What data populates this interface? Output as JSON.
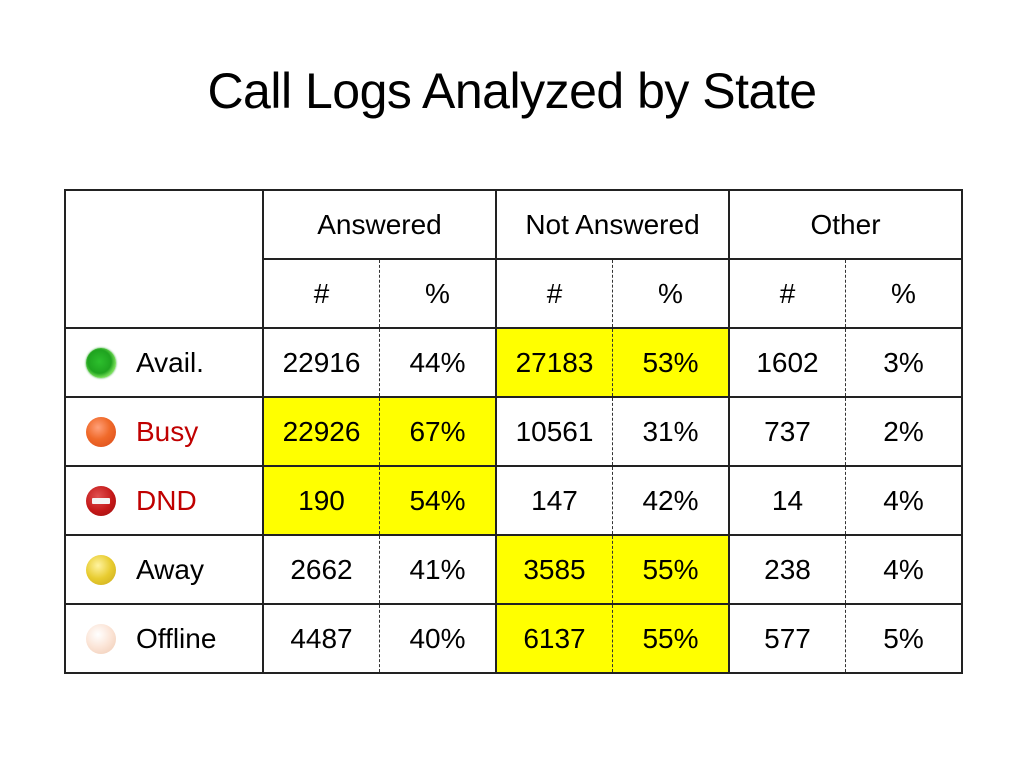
{
  "title": "Call Logs Analyzed by State",
  "headers": {
    "groups": [
      "Answered",
      "Not Answered",
      "Other"
    ],
    "sub": [
      "#",
      "%",
      "#",
      "%",
      "#",
      "%"
    ]
  },
  "highlight_color": "#ffff00",
  "rows": [
    {
      "state": "Avail.",
      "icon": "green-status-icon",
      "label_color": "#000000",
      "cells": [
        "22916",
        "44%",
        "27183",
        "53%",
        "1602",
        "3%"
      ],
      "highlight": [
        "not_answered"
      ]
    },
    {
      "state": "Busy",
      "icon": "orange-status-icon",
      "label_color": "#c00000",
      "cells": [
        "22926",
        "67%",
        "10561",
        "31%",
        "737",
        "2%"
      ],
      "highlight": [
        "answered"
      ]
    },
    {
      "state": "DND",
      "icon": "do-not-disturb-icon",
      "label_color": "#c00000",
      "cells": [
        "190",
        "54%",
        "147",
        "42%",
        "14",
        "4%"
      ],
      "highlight": [
        "answered"
      ]
    },
    {
      "state": "Away",
      "icon": "yellow-status-icon",
      "label_color": "#000000",
      "cells": [
        "2662",
        "41%",
        "3585",
        "55%",
        "238",
        "4%"
      ],
      "highlight": [
        "not_answered"
      ]
    },
    {
      "state": "Offline",
      "icon": "offline-status-icon",
      "label_color": "#000000",
      "cells": [
        "4487",
        "40%",
        "6137",
        "55%",
        "577",
        "5%"
      ],
      "highlight": [
        "not_answered"
      ]
    }
  ]
}
